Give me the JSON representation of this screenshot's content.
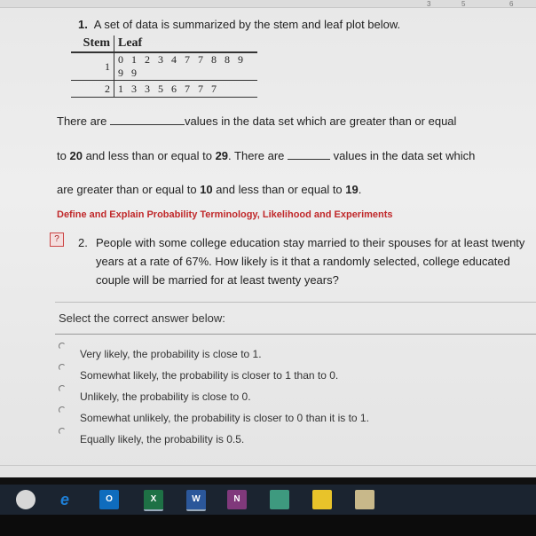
{
  "question1": {
    "number": "1.",
    "text": "A set of data is summarized by the stem and leaf plot below."
  },
  "stem_leaf": {
    "headers": {
      "stem": "Stem",
      "leaf": "Leaf"
    },
    "rows": [
      {
        "stem": "1",
        "leaf": "0 1 2 3 4 7 7 8 8 9 9 9"
      },
      {
        "stem": "2",
        "leaf": "1 3 3 5 6 7 7 7"
      }
    ]
  },
  "paragraph": {
    "l1a": "There are",
    "l1b": "values in the data set which are greater than or equal",
    "l2a": "to",
    "l2_n1": "20",
    "l2b": "and less than or equal to",
    "l2_n2": "29",
    "l2c": ". There are",
    "l2d": "values in the data set which",
    "l3a": "are greater than or equal to",
    "l3_n1": "10",
    "l3b": "and less than or equal to",
    "l3_n2": "19",
    "l3c": "."
  },
  "section_title": "Define and Explain Probability Terminology, Likelihood and Experiments",
  "question2": {
    "number": "2.",
    "text": "People with some college education stay married to their spouses for at least twenty years at a rate of 67%. How likely is it that a randomly selected, college educated couple will be married for at least twenty years?"
  },
  "select_label": "Select the correct answer below:",
  "options": [
    "Very likely, the probability is close to 1.",
    "Somewhat likely, the probability is closer to 1 than to 0.",
    "Unlikely, the probability is close to 0.",
    "Somewhat unlikely, the probability is closer to 0 than it is to 1.",
    "Equally likely, the probability is 0.5."
  ],
  "ruler_marks": [
    "3",
    "5",
    "6"
  ],
  "taskbar": {
    "icons": [
      {
        "name": "chrome-icon",
        "label": "",
        "color": "#d7d7d7"
      },
      {
        "name": "edge-icon",
        "label": "e",
        "color": "#1e7fd6"
      },
      {
        "name": "outlook-icon",
        "label": "O",
        "color": "#0f6cbd"
      },
      {
        "name": "excel-icon",
        "label": "X",
        "color": "#1e7145"
      },
      {
        "name": "word-icon",
        "label": "W",
        "color": "#2b579a"
      },
      {
        "name": "onenote-icon",
        "label": "N",
        "color": "#80397b"
      },
      {
        "name": "publisher-icon",
        "label": "",
        "color": "#3e9a7f"
      },
      {
        "name": "sticky-notes-icon",
        "label": "",
        "color": "#e8c32a"
      },
      {
        "name": "paint-icon",
        "label": "",
        "color": "#c8b88a"
      }
    ]
  }
}
